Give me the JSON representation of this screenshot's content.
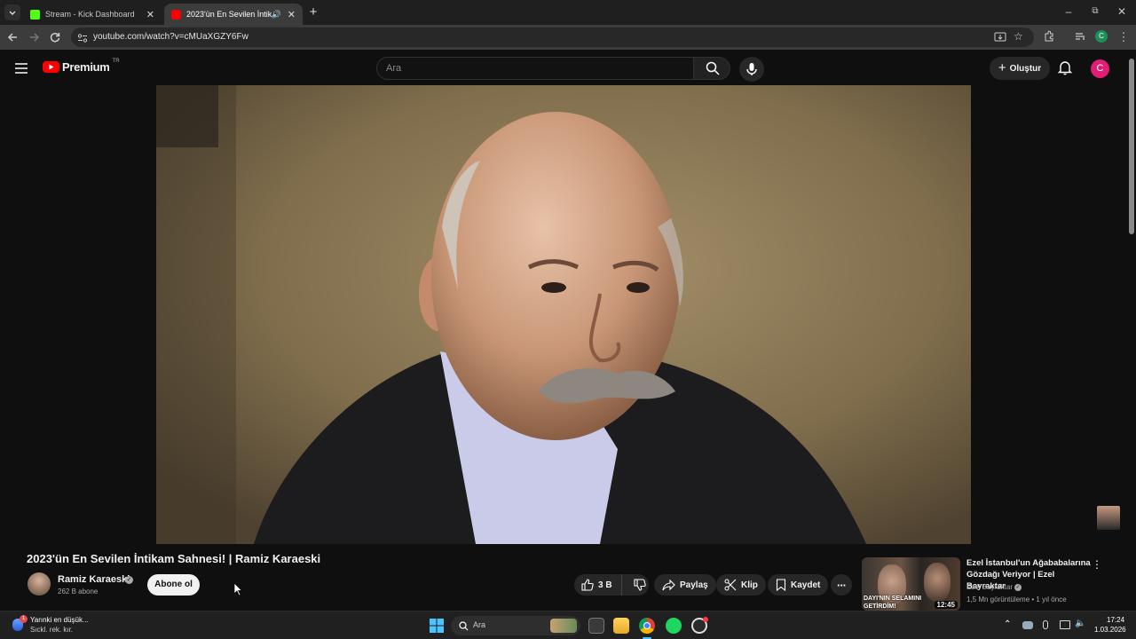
{
  "browser": {
    "tabs": [
      {
        "title": "Stream - Kick Dashboard",
        "active": false
      },
      {
        "title": "2023'ün En Sevilen İntikam",
        "active": true
      }
    ],
    "url": "youtube.com/watch?v=cMUaXGZY6Fw"
  },
  "youtube": {
    "logo_text": "Premium",
    "logo_region": "TR",
    "search_placeholder": "Ara",
    "create_label": "Oluştur",
    "avatar_letter": "C"
  },
  "video": {
    "title": "2023'ün En Sevilen İntikam Sahnesi! | Ramiz Karaeski",
    "channel_name": "Ramiz Karaeski",
    "subscribers": "262 B abone",
    "subscribe_label": "Abone ol",
    "likes": "3 B",
    "share_label": "Paylaş",
    "clip_label": "Klip",
    "save_label": "Kaydet"
  },
  "recommendation": {
    "title": "Ezel İstanbul'un Ağababalarına Gözdağı Veriyor | Ezel Bayraktar",
    "channel": "Ezel Bayraktar",
    "meta": "1,5 Mn görüntüleme • 1 yıl önce",
    "duration": "12:45",
    "thumb_caption": "DAYI'NIN SELAMINI GETİRDİM!"
  },
  "taskbar": {
    "weather_line1": "Yarınki en düşük...",
    "weather_line2": "Sıckl. rek. kır.",
    "search_label": "Ara",
    "time": "17:24",
    "date": "1.03.2026"
  },
  "colors": {
    "youtube_red": "#ff0000",
    "avatar_pink": "#e11d74",
    "kick_green": "#53fc18"
  }
}
